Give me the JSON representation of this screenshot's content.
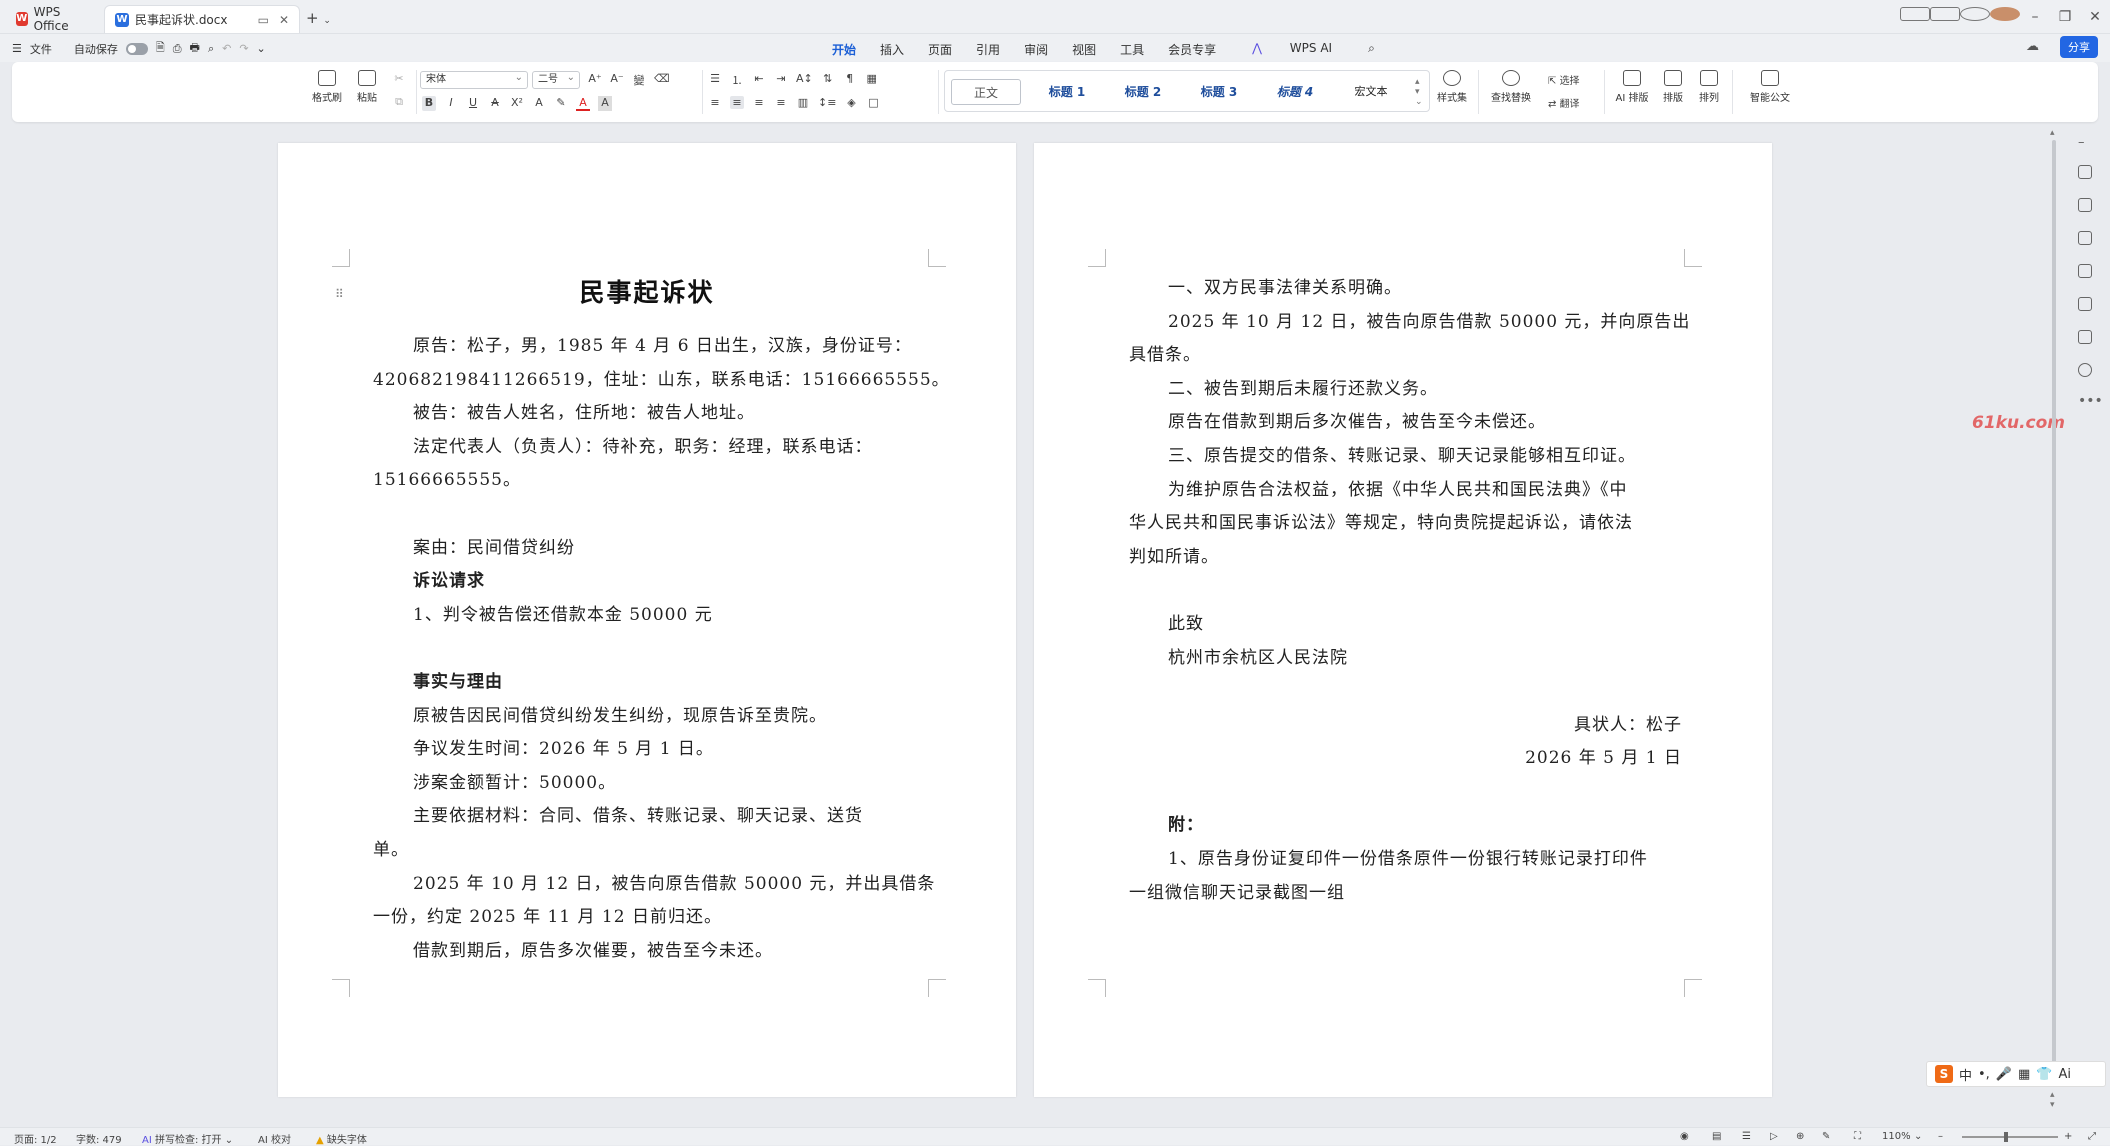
{
  "titlebar": {
    "app_tab": "WPS Office",
    "doc_tab": "民事起诉状.docx",
    "new_tab": "+"
  },
  "menubar": {
    "file": "文件",
    "autosave": "自动保存",
    "menus": [
      "开始",
      "插入",
      "页面",
      "引用",
      "审阅",
      "视图",
      "工具",
      "会员专享",
      "WPS AI"
    ],
    "active_menu": "开始",
    "share": "分享"
  },
  "ribbon": {
    "format_painter": "格式刷",
    "paste": "粘贴",
    "font_name": "宋体",
    "font_size": "二号",
    "styles": [
      "正文",
      "标题 1",
      "标题 2",
      "标题 3",
      "标题 4",
      "宏文本"
    ],
    "style_set": "样式集",
    "find_replace": "查找替换",
    "select": "选择",
    "translate": "翻译",
    "ai_layout": "AI 排版",
    "layout": "排版",
    "arrange": "排列",
    "smart_doc": "智能公文"
  },
  "page1": {
    "title": "民事起诉状",
    "lines": [
      "原告：松子，男，1985 年 4 月 6 日出生，汉族，身份证号：",
      "420682198411266519，住址：山东，联系电话：15166665555。",
      "被告：被告人姓名，住所地：被告人地址。",
      "法定代表人（负责人）：待补充，职务：经理，联系电话：",
      "15166665555。",
      "案由：民间借贷纠纷",
      "诉讼请求",
      "1、判令被告偿还借款本金 50000 元",
      "事实与理由",
      "原被告因民间借贷纠纷发生纠纷，现原告诉至贵院。",
      "争议发生时间：2026 年 5 月 1 日。",
      "涉案金额暂计：50000。",
      "主要依据材料：合同、借条、转账记录、聊天记录、送货",
      "单。",
      "2025 年 10 月 12 日，被告向原告借款 50000 元，并出具借条",
      "一份，约定 2025 年 11 月 12 日前归还。",
      "借款到期后，原告多次催要，被告至今未还。"
    ]
  },
  "page2": {
    "lines": [
      "一、双方民事法律关系明确。",
      "2025 年 10 月 12 日，被告向原告借款 50000 元，并向原告出",
      "具借条。",
      "二、被告到期后未履行还款义务。",
      "原告在借款到期后多次催告，被告至今未偿还。",
      "三、原告提交的借条、转账记录、聊天记录能够相互印证。",
      "为维护原告合法权益，依据《中华人民共和国民法典》《中",
      "华人民共和国民事诉讼法》等规定，特向贵院提起诉讼，请依法",
      "判如所请。",
      "此致",
      "杭州市余杭区人民法院",
      "具状人：松子",
      "2026 年 5 月 1 日",
      "附：",
      "1、原告身份证复印件一份借条原件一份银行转账记录打印件",
      "一组微信聊天记录截图一组"
    ]
  },
  "watermark": "61ku.com",
  "ime": {
    "items": [
      "S",
      "中",
      "•,",
      "🎤",
      "▦",
      "👕",
      "Ai"
    ]
  },
  "statusbar": {
    "page": "页面: 1/2",
    "words": "字数: 479",
    "spellcheck": "拼写检查: 打开",
    "ai_check": "AI 校对",
    "missing_font": "缺失字体",
    "zoom": "110%"
  }
}
